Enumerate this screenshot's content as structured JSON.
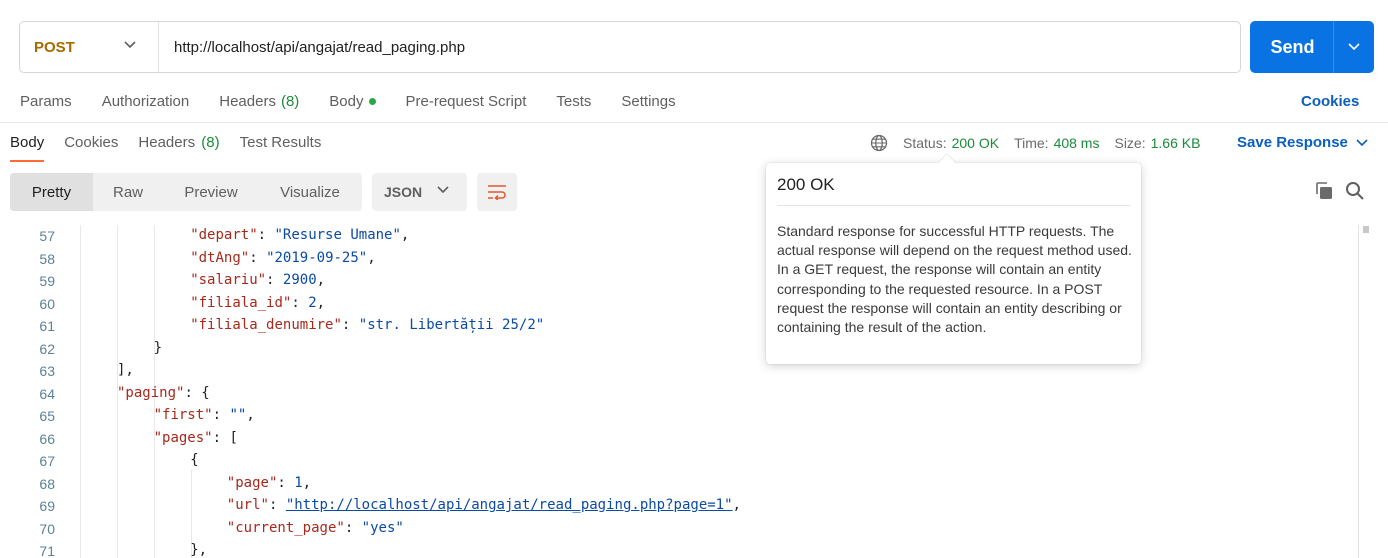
{
  "request": {
    "method": "POST",
    "url": "http://localhost/api/angajat/read_paging.php",
    "send_label": "Send"
  },
  "request_tabs": [
    {
      "label": "Params"
    },
    {
      "label": "Authorization"
    },
    {
      "label": "Headers",
      "count": "(8)"
    },
    {
      "label": "Body",
      "indicator": "green-dot"
    },
    {
      "label": "Pre-request Script"
    },
    {
      "label": "Tests"
    },
    {
      "label": "Settings"
    }
  ],
  "cookies_link": "Cookies",
  "response_tabs": [
    {
      "label": "Body",
      "active": true
    },
    {
      "label": "Cookies"
    },
    {
      "label": "Headers",
      "count": "(8)"
    },
    {
      "label": "Test Results"
    }
  ],
  "status": {
    "status_label": "Status:",
    "status_value": "200 OK",
    "time_label": "Time:",
    "time_value": "408 ms",
    "size_label": "Size:",
    "size_value": "1.66 KB"
  },
  "save_response": "Save Response",
  "format_tabs": [
    "Pretty",
    "Raw",
    "Preview",
    "Visualize"
  ],
  "format_select": "JSON",
  "tooltip": {
    "title": "200 OK",
    "body": "Standard response for successful HTTP requests. The actual response will depend on the request method used. In a GET request, the response will contain an entity corresponding to the requested resource. In a POST request the response will contain an entity describing or containing the result of the action."
  },
  "code_lines": [
    {
      "num": "57",
      "indent": 2,
      "key": "depart",
      "value": "\"Resurse Umane\"",
      "vtype": "s",
      "trail": ","
    },
    {
      "num": "58",
      "indent": 2,
      "key": "dtAng",
      "value": "\"2019-09-25\"",
      "vtype": "s",
      "trail": ","
    },
    {
      "num": "59",
      "indent": 2,
      "key": "salariu",
      "value": "2900",
      "vtype": "n",
      "trail": ","
    },
    {
      "num": "60",
      "indent": 2,
      "key": "filiala_id",
      "value": "2",
      "vtype": "n",
      "trail": ","
    },
    {
      "num": "61",
      "indent": 2,
      "key": "filiala_denumire",
      "value": "\"str. Libertății 25/2\"",
      "vtype": "s",
      "trail": ""
    },
    {
      "num": "62",
      "indent": 1,
      "text": "}"
    },
    {
      "num": "63",
      "indent": 0,
      "text": "],"
    },
    {
      "num": "64",
      "indent": 0,
      "key": "paging",
      "value": "{",
      "vtype": "p",
      "trail": ""
    },
    {
      "num": "65",
      "indent": 1,
      "key": "first",
      "value": "\"\"",
      "vtype": "s",
      "trail": ","
    },
    {
      "num": "66",
      "indent": 1,
      "key": "pages",
      "value": "[",
      "vtype": "p",
      "trail": ""
    },
    {
      "num": "67",
      "indent": 2,
      "text": "{"
    },
    {
      "num": "68",
      "indent": 3,
      "key": "page",
      "value": "1",
      "vtype": "n",
      "trail": ","
    },
    {
      "num": "69",
      "indent": 3,
      "key": "url",
      "value": "\"http://localhost/api/angajat/read_paging.php?page=1\"",
      "vtype": "u",
      "trail": ","
    },
    {
      "num": "70",
      "indent": 3,
      "key": "current_page",
      "value": "\"yes\"",
      "vtype": "s",
      "trail": ""
    },
    {
      "num": "71",
      "indent": 2,
      "text": "},"
    }
  ]
}
